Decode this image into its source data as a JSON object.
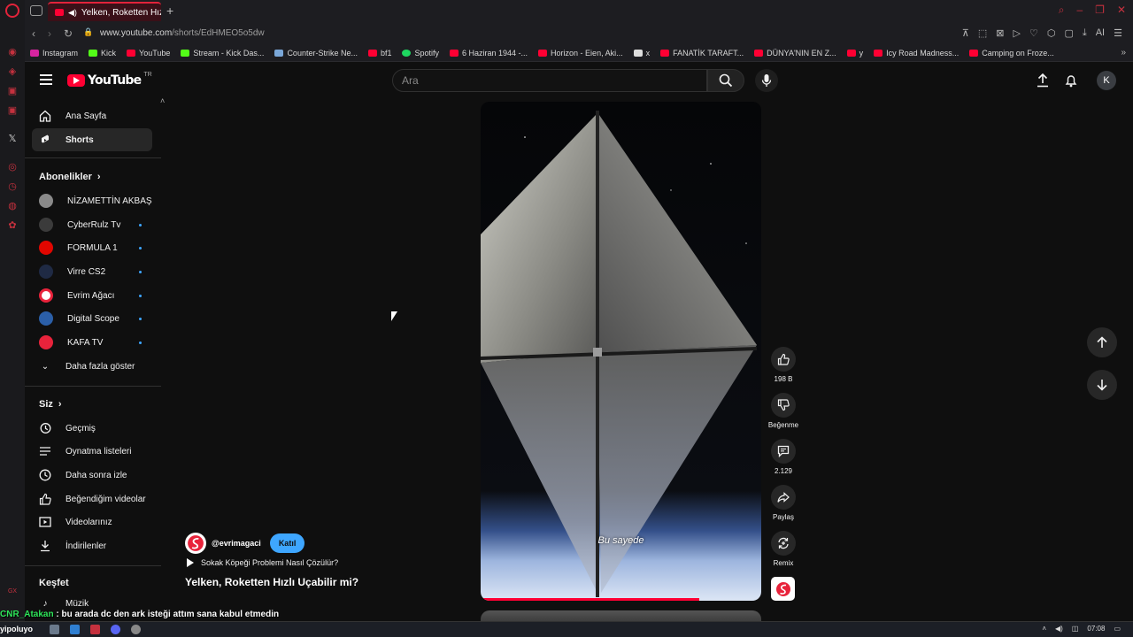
{
  "browser": {
    "tab_title": "Yelken, Roketten Hızlı U",
    "url_prefix": "www.youtube.com",
    "url_path": "/shorts/EdHMEO5o5dw",
    "bookmarks": [
      {
        "label": "Instagram",
        "color": "#d6249f"
      },
      {
        "label": "Kick",
        "color": "#53fc18"
      },
      {
        "label": "YouTube",
        "color": "#ff0033"
      },
      {
        "label": "Stream - Kick Das...",
        "color": "#53fc18"
      },
      {
        "label": "Counter-Strike Ne...",
        "color": "#7aa7d8"
      },
      {
        "label": "bf1",
        "color": "#ff0033"
      },
      {
        "label": "Spotify",
        "color": "#1ed760"
      },
      {
        "label": "6 Haziran 1944 -...",
        "color": "#ff0033"
      },
      {
        "label": "Horizon - Eien, Aki...",
        "color": "#ff0033"
      },
      {
        "label": "x",
        "color": "#dddddd"
      },
      {
        "label": "FANATİK TARAFT...",
        "color": "#ff0033"
      },
      {
        "label": "DÜNYA'NIN EN Z...",
        "color": "#ff0033"
      },
      {
        "label": "y",
        "color": "#ff0033"
      },
      {
        "label": "Icy Road Madness...",
        "color": "#ff0033"
      },
      {
        "label": "Camping on Froze...",
        "color": "#ff0033"
      }
    ]
  },
  "masthead": {
    "logo_text": "YouTube",
    "logo_region": "TR",
    "search_placeholder": "Ara",
    "avatar_letter": "K"
  },
  "guide": {
    "main": [
      {
        "label": "Ana Sayfa",
        "icon": "home-icon"
      },
      {
        "label": "Shorts",
        "icon": "shorts-icon"
      }
    ],
    "subscriptions_header": "Abonelikler",
    "subscriptions": [
      {
        "label": "NİZAMETTİN AKBAŞ",
        "color": "#8a8a8a",
        "new": false
      },
      {
        "label": "CyberRulz Tv",
        "color": "#3b3b3b",
        "new": true
      },
      {
        "label": "FORMULA 1",
        "color": "#e10600",
        "new": true
      },
      {
        "label": "Virre CS2",
        "color": "#1f2a44",
        "new": true
      },
      {
        "label": "Evrim Ağacı",
        "color": "#ffffff",
        "new": true
      },
      {
        "label": "Digital Scope",
        "color": "#2b5fa8",
        "new": true
      },
      {
        "label": "KAFA TV",
        "color": "#e8233b",
        "new": true
      }
    ],
    "show_more": "Daha fazla göster",
    "you_header": "Siz",
    "you_items": [
      {
        "label": "Geçmiş",
        "icon": "history-icon"
      },
      {
        "label": "Oynatma listeleri",
        "icon": "playlists-icon"
      },
      {
        "label": "Daha sonra izle",
        "icon": "watch-later-icon"
      },
      {
        "label": "Beğendiğim videolar",
        "icon": "liked-icon"
      },
      {
        "label": "Videolarınız",
        "icon": "your-videos-icon"
      },
      {
        "label": "İndirilenler",
        "icon": "downloads-icon"
      }
    ],
    "explore_header": "Keşfet",
    "explore_items": [
      {
        "label": "Müzik",
        "icon": "music-icon"
      }
    ]
  },
  "short": {
    "caption": "Bu sayede",
    "progress": 0.78,
    "channel": "@evrimagaci",
    "join_label": "Katıl",
    "linked_video": "Sokak Köpeği Problemi Nasıl Çözülür?",
    "title": "Yelken, Roketten Hızlı Uçabilir mi?",
    "likes": "198 B",
    "dislike_label": "Beğenme",
    "comments": "2.129",
    "share_label": "Paylaş",
    "remix_label": "Remix"
  },
  "overlay": {
    "chat_user": "CNR_Atakan",
    "chat_message": " : bu arada dc den ark isteği attım sana kabul etmedin",
    "taskbar_left": "yipoluyo",
    "clock": "07:08"
  }
}
